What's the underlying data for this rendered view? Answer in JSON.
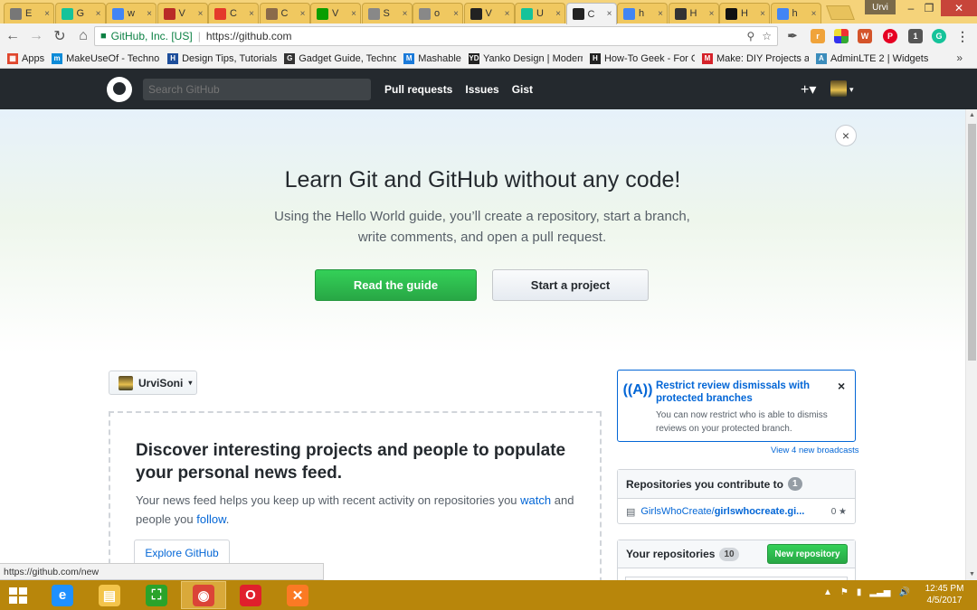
{
  "browser": {
    "tabs": [
      {
        "label": "E",
        "icon": "document-icon",
        "color": "#777777",
        "close": "×"
      },
      {
        "label": "G",
        "icon": "grammarly-icon",
        "color": "#15c39a",
        "close": "×"
      },
      {
        "label": "w",
        "icon": "google-icon",
        "color": "#4285f4",
        "close": "×"
      },
      {
        "label": "V",
        "icon": "quora-icon",
        "color": "#b92b27",
        "close": "×"
      },
      {
        "label": "C",
        "icon": "tnw-icon",
        "color": "#e4392b",
        "close": "×"
      },
      {
        "label": "C",
        "icon": "profile-icon",
        "color": "#8a6a4a",
        "close": "×"
      },
      {
        "label": "V",
        "icon": "techcrunch-icon",
        "color": "#0a9e01",
        "close": "×"
      },
      {
        "label": "S",
        "icon": "upload-icon",
        "color": "#888888",
        "close": "×"
      },
      {
        "label": "o",
        "icon": "upload-icon",
        "color": "#888888",
        "close": "×"
      },
      {
        "label": "V",
        "icon": "github-icon",
        "color": "#222222",
        "close": "×"
      },
      {
        "label": "U",
        "icon": "grammarly-icon",
        "color": "#15c39a",
        "close": "×"
      },
      {
        "label": "C",
        "icon": "github-icon",
        "color": "#222222",
        "close": "×",
        "active": true
      },
      {
        "label": "h",
        "icon": "google-icon",
        "color": "#4285f4",
        "close": "×"
      },
      {
        "label": "H",
        "icon": "htg-icon",
        "color": "#333333",
        "close": "×"
      },
      {
        "label": "H",
        "icon": "lifehacker-icon",
        "color": "#111111",
        "close": "×"
      },
      {
        "label": "h",
        "icon": "google-icon",
        "color": "#4285f4",
        "close": "×"
      }
    ],
    "window_user": "Urvi",
    "window_controls": {
      "minimize": "–",
      "maximize": "❐",
      "close": "✕"
    },
    "nav": {
      "back": "←",
      "forward": "→",
      "reload": "↻",
      "home": "⌂"
    },
    "omnibox": {
      "secure_label": "GitHub, Inc. [US]",
      "separator": "|",
      "url": "https://github.com",
      "key_icon": "key-icon",
      "star": "☆"
    },
    "bookmarks": [
      {
        "label": "Apps",
        "icon": "apps-grid-icon",
        "color": "#e0462d",
        "glyph": "▦"
      },
      {
        "label": "MakeUseOf - Technol",
        "icon": "makeuseof-icon",
        "color": "#0d8bd8",
        "glyph": "m"
      },
      {
        "label": "Design Tips, Tutorials",
        "icon": "hongkiat-icon",
        "color": "#1d4e9b",
        "glyph": "H"
      },
      {
        "label": "Gadget Guide, Techno",
        "icon": "gadget-icon",
        "color": "#333333",
        "glyph": "G"
      },
      {
        "label": "Mashable",
        "icon": "mashable-icon",
        "color": "#1a7ad9",
        "glyph": "M"
      },
      {
        "label": "Yanko Design | Modern",
        "icon": "yanko-icon",
        "color": "#222222",
        "glyph": "YD"
      },
      {
        "label": "How-To Geek - For Gr",
        "icon": "htg-icon",
        "color": "#222222",
        "glyph": "H"
      },
      {
        "label": "Make: DIY Projects an",
        "icon": "make-icon",
        "color": "#d5222a",
        "glyph": "M"
      },
      {
        "label": "AdminLTE 2 | Widgets",
        "icon": "adminlte-icon",
        "color": "#3c8dbc",
        "glyph": "A"
      }
    ],
    "bookmarks_more": "»",
    "status_url": "https://github.com/new"
  },
  "github": {
    "search_placeholder": "Search GitHub",
    "nav": [
      "Pull requests",
      "Issues",
      "Gist"
    ],
    "plus": "+▾",
    "avatar_caret": "▾"
  },
  "hero": {
    "close": "×",
    "title": "Learn Git and GitHub without any code!",
    "subtitle": "Using the Hello World guide, you’ll create a repository, start a branch, write comments, and open a pull request.",
    "primary_button": "Read the guide",
    "secondary_button": "Start a project"
  },
  "dashboard": {
    "context_user": "UrviSoni",
    "context_caret": "▾",
    "feed": {
      "title": "Discover interesting projects and people to populate your personal news feed.",
      "text_before": "Your news feed helps you keep up with recent activity on repositories you ",
      "watch_link": "watch",
      "text_middle": " and people you ",
      "follow_link": "follow",
      "text_end": ".",
      "explore_button": "Explore GitHub"
    },
    "broadcast": {
      "title": "Restrict review dismissals with protected branches",
      "text": "You can now restrict who is able to dismiss reviews on your protected branch.",
      "close": "×",
      "more_link": "View 4 new broadcasts"
    },
    "contribute_box": {
      "title": "Repositories you contribute to",
      "count": "1",
      "repo_owner": "GirlsWhoCreate/",
      "repo_name": "girlswhocreate.gi...",
      "stars": "0",
      "star_glyph": "★"
    },
    "your_repos_box": {
      "title": "Your repositories",
      "count": "10",
      "new_button": "New repository"
    }
  },
  "taskbar": {
    "apps": [
      {
        "name": "internet-explorer-icon",
        "color": "#1e90ff",
        "glyph": "e"
      },
      {
        "name": "file-explorer-icon",
        "color": "#f3c44a",
        "glyph": "▤"
      },
      {
        "name": "windows-store-icon",
        "color": "#2aa32a",
        "glyph": "⛶"
      },
      {
        "name": "chrome-icon",
        "color": "#db4437",
        "glyph": "◉",
        "active": true
      },
      {
        "name": "opera-icon",
        "color": "#e0202c",
        "glyph": "O"
      },
      {
        "name": "xampp-icon",
        "color": "#fb7a24",
        "glyph": "✕"
      }
    ],
    "tray": [
      "▲",
      "⚑",
      "▮",
      "▂▃▅",
      "🔊"
    ],
    "time": "12:45 PM",
    "date": "4/5/2017"
  }
}
